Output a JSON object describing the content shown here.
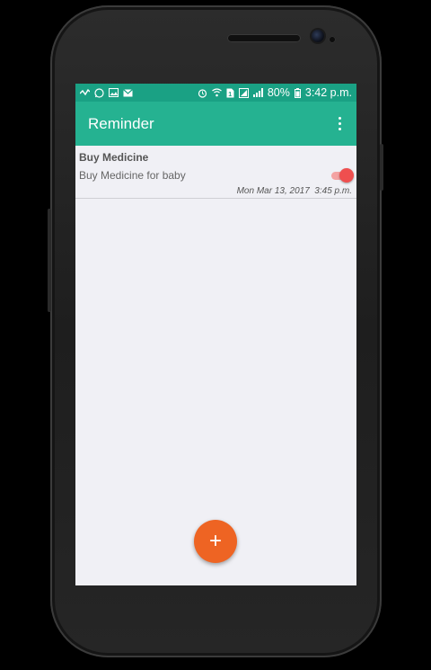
{
  "status_bar": {
    "battery": "80%",
    "time": "3:42 p.m.",
    "icons_left": [
      "signal-wave-icon",
      "whatsapp-icon",
      "image-icon",
      "mail-icon"
    ],
    "icons_right": [
      "alarm-icon",
      "wifi-icon",
      "sim-icon",
      "signal-icon",
      "signal-bars-icon",
      "battery-icon"
    ]
  },
  "toolbar": {
    "title": "Reminder",
    "menu_icon": "overflow-menu-icon"
  },
  "reminders": [
    {
      "title": "Buy Medicine",
      "description": "Buy Medicine for baby",
      "datetime": "Mon Mar 13, 2017  3:45 p.m.",
      "enabled": true
    }
  ],
  "fab": {
    "label": "+",
    "icon": "add-icon"
  },
  "colors": {
    "status_bar": "#1aa184",
    "toolbar": "#25b291",
    "fab": "#ee6423",
    "toggle_on": "#ef4f4f",
    "screen_bg": "#f0f0f5"
  }
}
